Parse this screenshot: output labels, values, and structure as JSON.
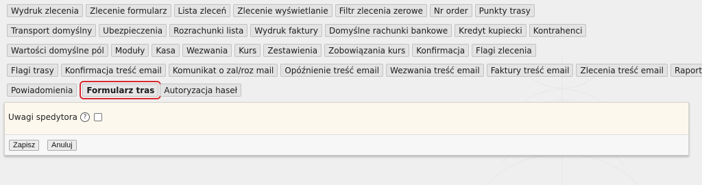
{
  "tabs": {
    "row1": [
      "Wydruk zlecenia",
      "Zlecenie formularz",
      "Lista zleceń",
      "Zlecenie wyświetlanie",
      "Filtr zlecenia zerowe",
      "Nr order",
      "Punkty trasy"
    ],
    "row2": [
      "Transport domyślny",
      "Ubezpieczenia",
      "Rozrachunki lista",
      "Wydruk faktury",
      "Domyślne rachunki bankowe",
      "Kredyt kupiecki",
      "Kontrahenci"
    ],
    "row3": [
      "Wartości domyślne pól",
      "Moduły",
      "Kasa",
      "Wezwania",
      "Kurs",
      "Zestawienia",
      "Zobowiązania kurs",
      "Konfirmacja",
      "Flagi zlecenia"
    ],
    "row4": [
      "Flagi trasy",
      "Konfirmacja treść email",
      "Komunikat o zal/roz mail",
      "Opóźnienie treść email",
      "Wezwania treść email",
      "Faktury treść email",
      "Zlecenia treść email",
      "Raport dla sp"
    ],
    "row5": [
      "Powiadomienia",
      "Formularz tras",
      "Autoryzacja haseł"
    ],
    "active": "Formularz tras"
  },
  "form": {
    "field_label": "Uwagi spedytora",
    "help_icon": "?",
    "checkbox_checked": false
  },
  "buttons": {
    "save": "Zapisz",
    "cancel": "Anuluj"
  },
  "colors": {
    "active_outline": "#d8282f",
    "panel_bg": "#fcf8ee"
  }
}
